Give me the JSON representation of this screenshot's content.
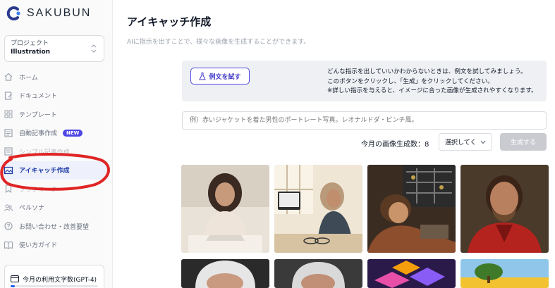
{
  "app": {
    "brand": "SAKUBUN"
  },
  "project": {
    "label": "プロジェクト",
    "value": "Illustration"
  },
  "nav": {
    "items": [
      {
        "label": "ホーム",
        "icon": "home-icon"
      },
      {
        "label": "ドキュメント",
        "icon": "document-icon"
      },
      {
        "label": "テンプレート",
        "icon": "template-icon"
      },
      {
        "label": "自動記事作成",
        "icon": "auto-article-icon",
        "badge": "NEW"
      },
      {
        "label": "シンプル記事作成",
        "icon": "simple-article-icon"
      },
      {
        "label": "アイキャッチ作成",
        "icon": "image-icon",
        "active": true
      },
      {
        "label": "ブックマーク",
        "icon": "bookmark-icon"
      },
      {
        "label": "ペルソナ",
        "icon": "persona-icon"
      },
      {
        "label": "お問い合わせ・改善要望",
        "icon": "help-icon"
      },
      {
        "label": "使い方ガイド",
        "icon": "guide-icon"
      }
    ]
  },
  "usage": {
    "label": "今月の利用文字数(GPT-4)"
  },
  "page": {
    "title": "アイキャッチ作成",
    "subtitle": "AIに指示を出すことで、様々な画像を生成することができます。"
  },
  "hint": {
    "try_button": "例文を試す",
    "line1": "どんな指示を出していいかわからないときは、例文を試してみましょう。",
    "line2": "このボタンをクリックし、「生成」をクリックしてください。",
    "line3": "※詳しい指示を与えると、イメージに合った画像が生成されやすくなります。"
  },
  "prompt": {
    "placeholder": "例）赤いジャケットを着た男性のポートレート写真。レオナルドダ・ビンチ風。"
  },
  "generation": {
    "count_label": "今月の画像生成数：8",
    "select_value": "選択してく",
    "generate_button": "生成する"
  },
  "colors": {
    "accent": "#4f46e5",
    "annotation": "#e02424",
    "active_bg": "#eef1fb"
  }
}
